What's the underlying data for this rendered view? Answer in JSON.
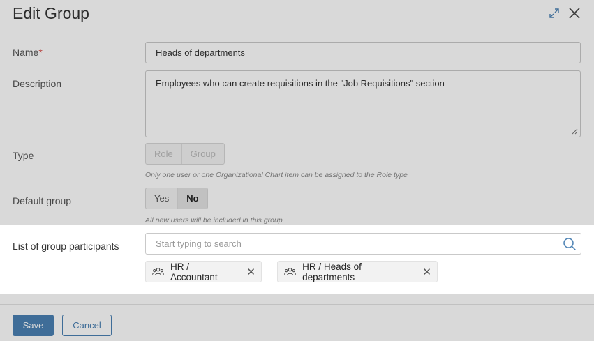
{
  "dialog": {
    "title": "Edit Group"
  },
  "header_icons": {
    "expand": "expand-icon",
    "close": "close-icon"
  },
  "form": {
    "name": {
      "label": "Name",
      "required_mark": "*",
      "value": "Heads of departments"
    },
    "description": {
      "label": "Description",
      "value": "Employees who can create requisitions in the \"Job Requisitions\" section"
    },
    "type": {
      "label": "Type",
      "options": [
        "Role",
        "Group"
      ],
      "hint": "Only one user or one Organizational Chart item can be assigned to the Role type"
    },
    "default_group": {
      "label": "Default group",
      "options": [
        "Yes",
        "No"
      ],
      "selected": "No",
      "hint": "All new users will be included in this group"
    },
    "participants": {
      "label": "List of group participants",
      "search_placeholder": "Start typing to search",
      "chips": [
        {
          "label": "HR / Accountant",
          "icon": "group-icon"
        },
        {
          "label": "HR / Heads of departments",
          "icon": "group-icon"
        }
      ]
    }
  },
  "footer": {
    "save_label": "Save",
    "cancel_label": "Cancel"
  },
  "colors": {
    "accent": "#4a80b3",
    "required": "#d9534f"
  }
}
